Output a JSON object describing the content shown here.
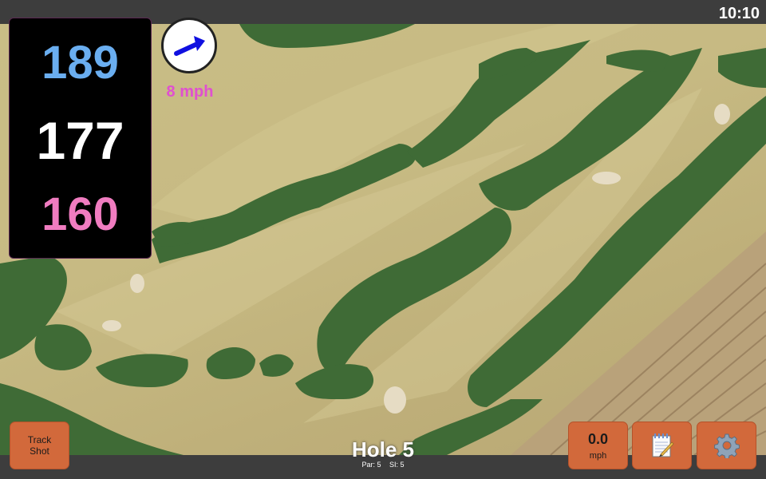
{
  "status": {
    "time": "10:10"
  },
  "distances": {
    "back": "189",
    "middle": "177",
    "front": "160",
    "colors": {
      "back": "#6aaef0",
      "middle": "#ffffff",
      "front": "#f07cc0"
    }
  },
  "wind": {
    "speed_label": "8 mph",
    "arrow_color": "#1010e0",
    "label_color": "#e050d0",
    "icon": "arrow-right-icon"
  },
  "hole": {
    "title": "Hole 5",
    "par_label": "Par: 5",
    "si_label": "SI: 5"
  },
  "buttons": {
    "track_shot_line1": "Track",
    "track_shot_line2": "Shot",
    "speed_value": "0.0",
    "speed_unit": "mph",
    "notes_icon": "notepad-icon",
    "settings_icon": "gear-icon"
  },
  "colors": {
    "button_accent": "#d2693b",
    "bar_background": "#3d3d3d"
  }
}
